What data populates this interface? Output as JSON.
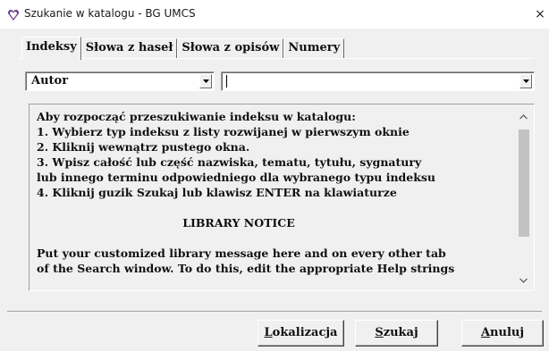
{
  "window": {
    "title": "Szukanie w katalogu - BG UMCS",
    "close_glyph": "×"
  },
  "tabs": [
    {
      "label": "Indeksy",
      "active": true
    },
    {
      "label": "Słowa z haseł",
      "active": false
    },
    {
      "label": "Słowa z opisów",
      "active": false
    },
    {
      "label": "Numery",
      "active": false
    }
  ],
  "index_type_select": {
    "value": "Autor"
  },
  "search_term_combo": {
    "value": ""
  },
  "help": {
    "lines": [
      "Aby rozpocząć przeszukiwanie indeksu w katalogu:",
      "1. Wybierz typ indeksu z listy rozwijanej w pierwszym oknie",
      "2. Kliknij wewnątrz pustego okna.",
      "3. Wpisz całość lub część nazwiska, tematu, tytułu, sygnatury",
      "lub innego terminu odpowiedniego dla wybranego typu indeksu",
      "4. Kliknij guzik Szukaj lub klawisz ENTER na klawiaturze"
    ],
    "notice_heading": "LIBRARY NOTICE",
    "notice_lines": [
      "Put your customized library message here and on every other tab",
      "of the Search window. To do this, edit the appropriate Help strings"
    ]
  },
  "buttons": {
    "locate": {
      "mnemonic": "L",
      "rest": "okalizacja"
    },
    "search": {
      "mnemonic": "S",
      "rest": "zukaj"
    },
    "cancel": {
      "mnemonic": "A",
      "rest": "nuluj"
    }
  },
  "icons": {
    "app": "heart-shield-icon",
    "dropdown": "chevron-down-icon",
    "scroll_up": "scroll-up-arrow-icon",
    "scroll_down": "scroll-down-arrow-icon"
  }
}
